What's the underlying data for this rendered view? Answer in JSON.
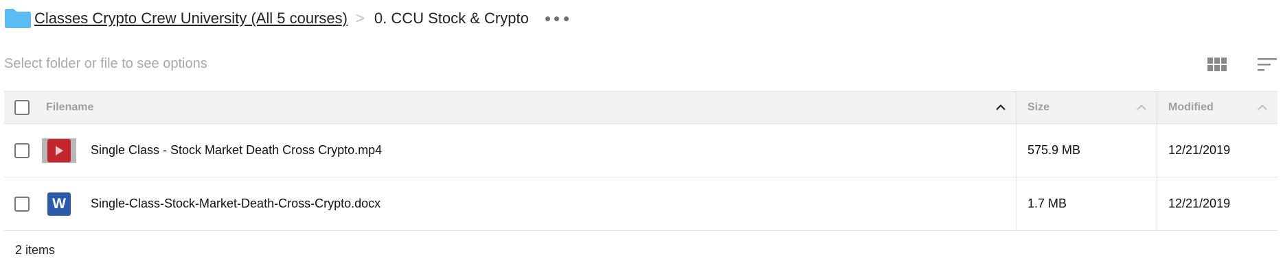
{
  "breadcrumb": {
    "parent_label": "Classes Crypto Crew University (All 5 courses)",
    "separator": ">",
    "current_label": "0. CCU Stock & Crypto"
  },
  "toolbar": {
    "hint": "Select folder or file to see options"
  },
  "table": {
    "columns": {
      "name": "Filename",
      "size": "Size",
      "modified": "Modified"
    },
    "rows": [
      {
        "name": "Single Class - Stock Market Death Cross Crypto.mp4",
        "size": "575.9 MB",
        "modified": "12/21/2019",
        "icon": "video-file-icon"
      },
      {
        "name": "Single-Class-Stock-Market-Death-Cross-Crypto.docx",
        "size": "1.7 MB",
        "modified": "12/21/2019",
        "icon": "word-file-icon",
        "icon_letter": "W"
      }
    ]
  },
  "footer": {
    "item_count": "2 items"
  },
  "colors": {
    "folder": "#5bbcf5",
    "video_play": "#c3262c",
    "word": "#2b5aa8",
    "header_bg": "#f2f2f2"
  }
}
